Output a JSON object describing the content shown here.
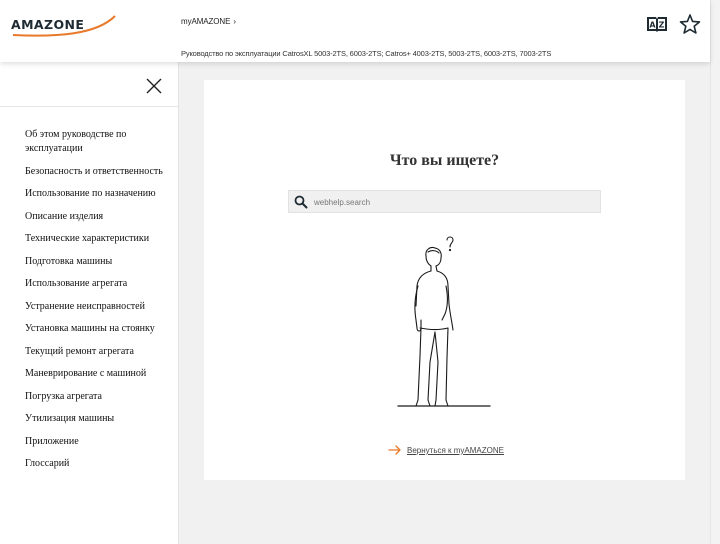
{
  "header": {
    "logo_text": "AMAZONE",
    "breadcrumb": "myAMAZONE",
    "breadcrumb_separator": "›",
    "document_title": "Руководство по эксплуатации CatrosXL 5003-2TS, 6003-2TS; Catros+ 4003-2TS, 5003-2TS, 6003-2TS, 7003-2TS",
    "icons": [
      "language-icon",
      "star-icon"
    ]
  },
  "sidebar": {
    "close_icon": "close-icon",
    "items": [
      {
        "label": "Об этом руководстве по эксплуатации"
      },
      {
        "label": "Безопасность и ответственность"
      },
      {
        "label": "Использование по назначению"
      },
      {
        "label": "Описание изделия"
      },
      {
        "label": "Технические характеристики"
      },
      {
        "label": "Подготовка машины"
      },
      {
        "label": "Использование агрегата"
      },
      {
        "label": "Устранение неисправностей"
      },
      {
        "label": "Установка машины на стоянку"
      },
      {
        "label": "Текущий ремонт агрегата"
      },
      {
        "label": "Маневрирование с машиной"
      },
      {
        "label": "Погрузка агрегата"
      },
      {
        "label": "Утилизация машины"
      },
      {
        "label": "Приложение"
      },
      {
        "label": "Глоссарий"
      }
    ]
  },
  "main": {
    "heading": "Что вы ищете?",
    "search": {
      "placeholder": "webhelp.search",
      "value": ""
    },
    "back_link": "Вернуться к myAMAZONE"
  },
  "colors": {
    "accent": "#e8792b",
    "text": "#222222",
    "background": "#f1f1f1"
  }
}
